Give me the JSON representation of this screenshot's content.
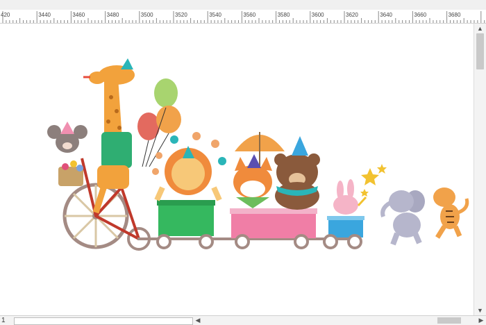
{
  "ruler": {
    "labels": [
      "420",
      "3440",
      "3460",
      "3480",
      "3500",
      "3520",
      "3540",
      "3560",
      "3580",
      "3600",
      "3620",
      "3640",
      "3660",
      "3680"
    ]
  },
  "statusbar": {
    "page_label": "1"
  },
  "icons": {
    "scroll_up": "chevron-up-icon",
    "scroll_down": "chevron-down-icon",
    "scroll_left": "chevron-left-icon",
    "scroll_right": "chevron-right-icon"
  }
}
